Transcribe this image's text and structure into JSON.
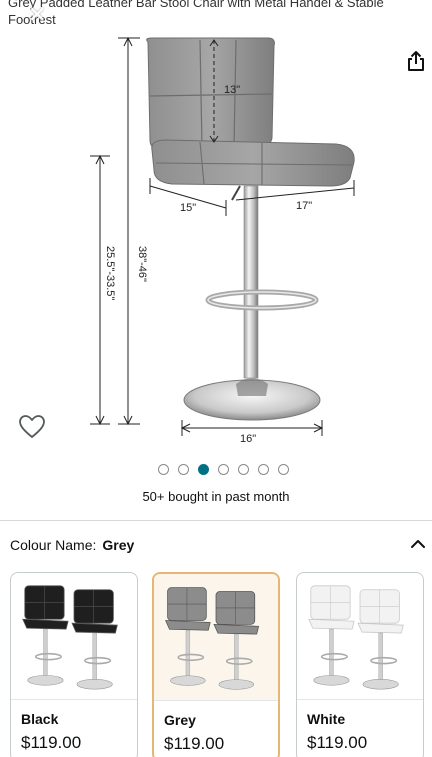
{
  "header": {
    "title": "Grey Padded Leather Bar Stool Chair with Metal Handel & Stable Footrest"
  },
  "product_image": {
    "dimensions": {
      "back_height": "13\"",
      "seat_depth": "15\"",
      "seat_width": "17\"",
      "total_height": "38\"-46\"",
      "seat_height": "25.5\"-33.5\"",
      "base_diameter": "16\""
    }
  },
  "carousel": {
    "total": 7,
    "active_index": 2
  },
  "social_proof": {
    "bought_text": "50+ bought in past month"
  },
  "variant_selector": {
    "label": "Colour Name:",
    "selected_value": "Grey",
    "options": [
      {
        "name": "Black",
        "price": "$119.00",
        "color": "#1f1f1f",
        "selected": false
      },
      {
        "name": "Grey",
        "price": "$119.00",
        "color": "#8c8c8c",
        "selected": true
      },
      {
        "name": "White",
        "price": "$119.00",
        "color": "#f2f2f2",
        "selected": false
      }
    ]
  },
  "colors": {
    "accent_dot": "#007185",
    "selected_border": "#e6b674"
  }
}
